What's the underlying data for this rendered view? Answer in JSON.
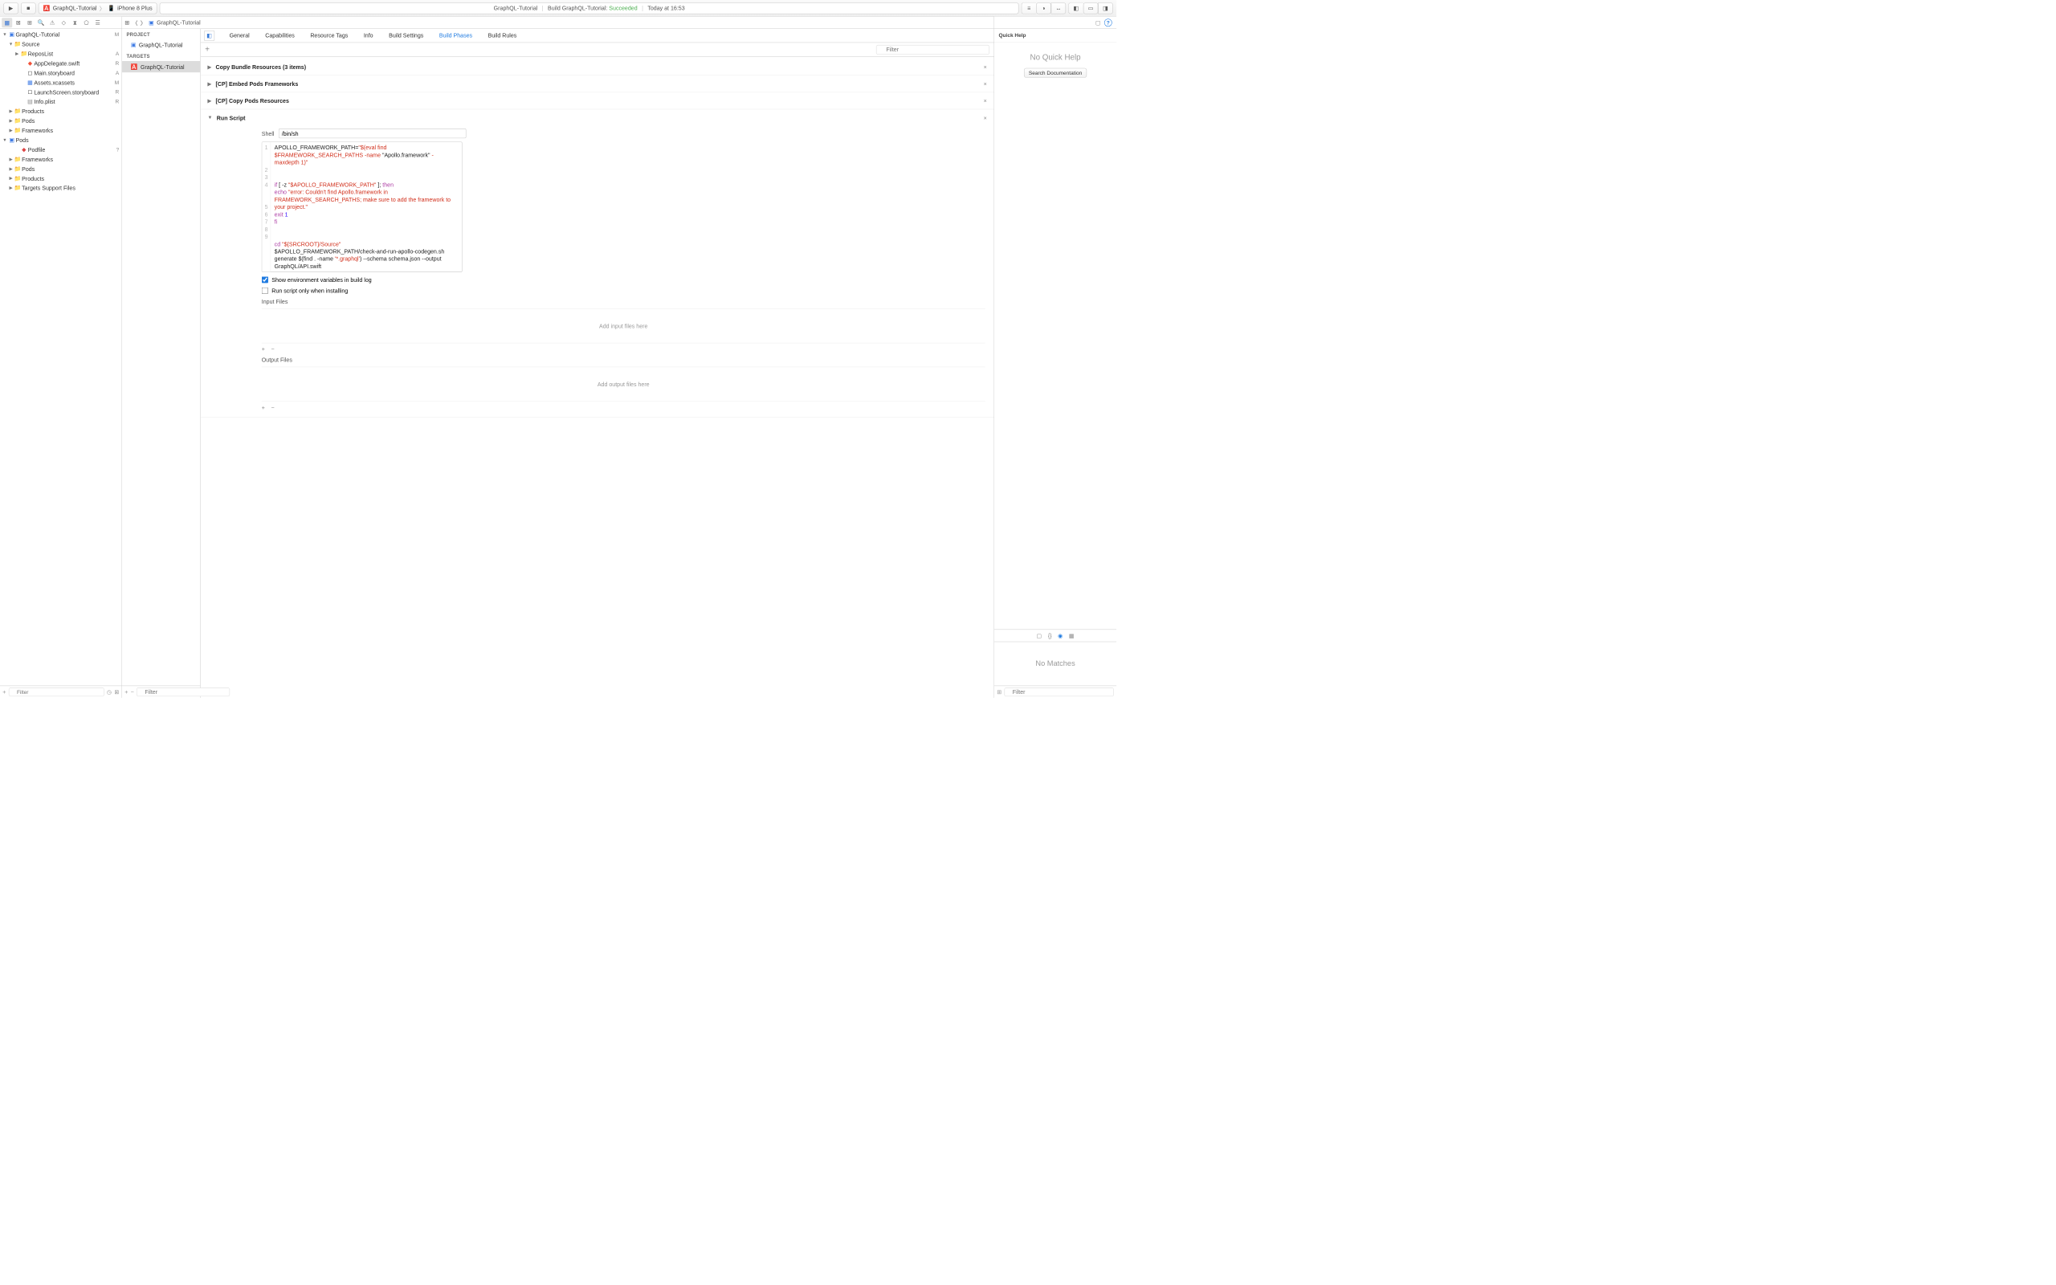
{
  "toolbar": {
    "scheme_name": "GraphQL-Tutorial",
    "scheme_dest": "iPhone 8 Plus",
    "activity_project": "GraphQL-Tutorial",
    "activity_status": "Build GraphQL-Tutorial:",
    "activity_result": "Succeeded",
    "activity_time": "Today at 16:53"
  },
  "navigator": {
    "root": "GraphQL-Tutorial",
    "root_badge": "M",
    "source": "Source",
    "repos": "ReposList",
    "appdelegate": "AppDelegate.swift",
    "main_sb": "Main.storyboard",
    "assets": "Assets.xcassets",
    "launch_sb": "LaunchScreen.storyboard",
    "info": "Info.plist",
    "products": "Products",
    "pods": "Pods",
    "frameworks": "Frameworks",
    "pods_root": "Pods",
    "podfile": "Podfile",
    "frameworks2": "Frameworks",
    "pods2": "Pods",
    "products2": "Products",
    "tsf": "Targets Support Files",
    "badges": {
      "repos": "A",
      "appdel": "R",
      "mainsb": "A",
      "assets": "M",
      "launchsb": "R",
      "info": "R",
      "podfile": "?"
    },
    "filter_placeholder": "Filter"
  },
  "jumpbar": {
    "project": "GraphQL-Tutorial"
  },
  "targets": {
    "project_hdr": "PROJECT",
    "project_name": "GraphQL-Tutorial",
    "targets_hdr": "TARGETS",
    "target_name": "GraphQL-Tutorial",
    "filter_placeholder": "Filter"
  },
  "editor_tabs": {
    "general": "General",
    "capabilities": "Capabilities",
    "resource_tags": "Resource Tags",
    "info": "Info",
    "build_settings": "Build Settings",
    "build_phases": "Build Phases",
    "build_rules": "Build Rules"
  },
  "phase_filter_placeholder": "Filter",
  "phases": {
    "copy_bundle": "Copy Bundle Resources (3 items)",
    "embed_pods": "[CP] Embed Pods Frameworks",
    "copy_pods": "[CP] Copy Pods Resources",
    "run_script": "Run Script"
  },
  "run_script": {
    "shell_label": "Shell",
    "shell_value": "/bin/sh",
    "show_env": "Show environment variables in build log",
    "only_install": "Run script only when installing",
    "input_files": "Input Files",
    "input_placeholder": "Add input files here",
    "output_files": "Output Files",
    "output_placeholder": "Add output files here"
  },
  "code": {
    "l1a": "APOLLO_FRAMEWORK_PATH=",
    "l1b": "\"$(eval find $FRAMEWORK_SEARCH_PATHS -name ",
    "l1c": "\"Apollo.framework\"",
    "l1d": " -maxdepth 1)\"",
    "l3a": "if",
    "l3b": " [ -z ",
    "l3c": "\"$APOLLO_FRAMEWORK_PATH\"",
    "l3d": " ]; ",
    "l3e": "then",
    "l4a": "echo",
    "l4b": " ",
    "l4c": "\"error: Couldn't find Apollo.framework in FRAMEWORK_SEARCH_PATHS; make sure to add the framework to your project.\"",
    "l5a": "exit",
    "l5b": " ",
    "l5c": "1",
    "l6": "fi",
    "l8a": "cd",
    "l8b": " ",
    "l8c": "\"${SRCROOT}/Source\"",
    "l9a": "$APOLLO_FRAMEWORK_PATH/check-and-run-apollo-codegen.sh generate $(find . -name ",
    "l9b": "'*.graphql'",
    "l9c": ") --schema schema.json --output GraphQL/API.swift"
  },
  "inspector": {
    "title": "Quick Help",
    "no_help": "No Quick Help",
    "search_doc": "Search Documentation",
    "no_matches": "No Matches",
    "filter_placeholder": "Filter"
  }
}
